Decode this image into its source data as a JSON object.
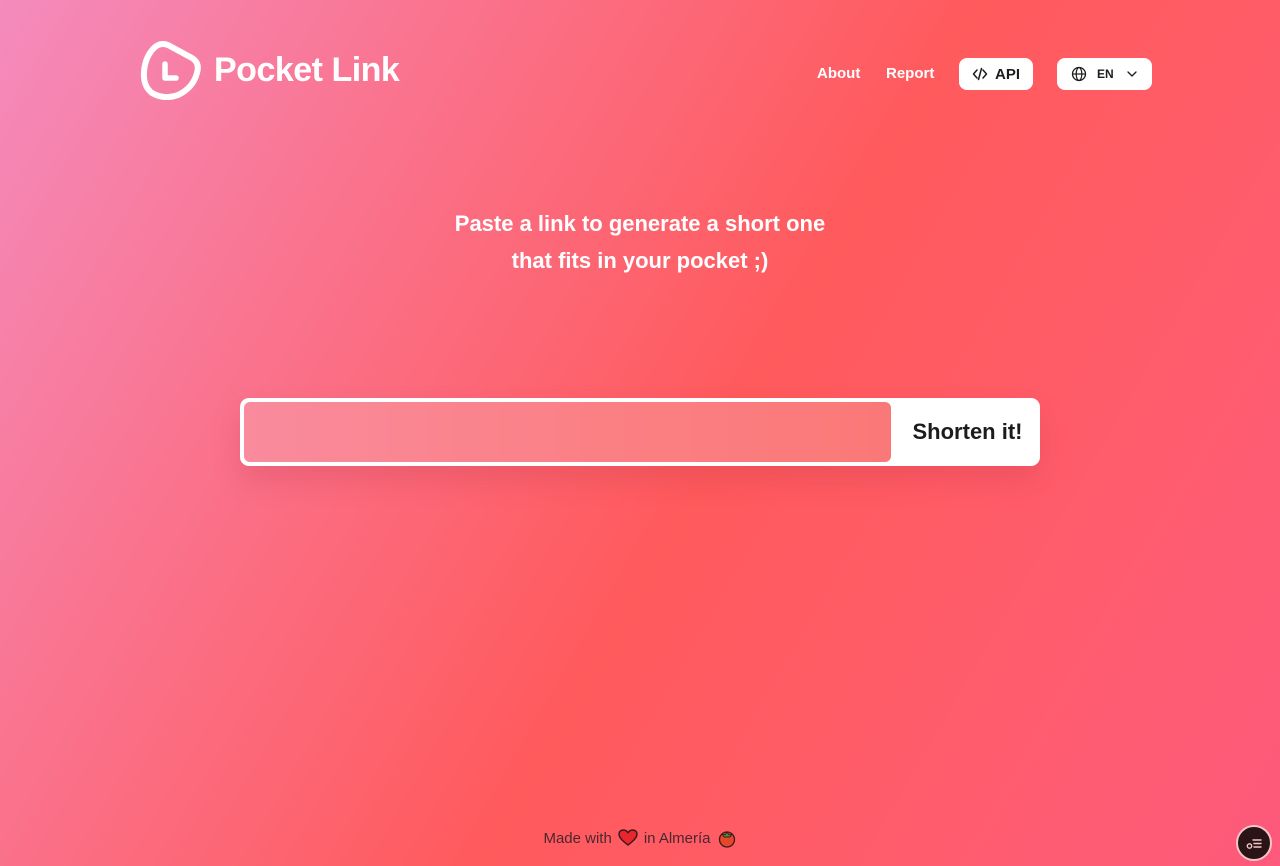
{
  "header": {
    "logo_text": "Pocket Link",
    "nav": {
      "about": "About",
      "report": "Report",
      "api": "API"
    },
    "language": {
      "selected": "EN"
    }
  },
  "hero": {
    "line1": "Paste a link to generate a short one",
    "line2": "that fits in your pocket ;)"
  },
  "form": {
    "input_value": "",
    "input_placeholder": "",
    "submit_label": "Shorten it!"
  },
  "footer": {
    "made_with": "Made with",
    "in_location": "in Almería"
  },
  "colors": {
    "accent_gradient_start": "#f48bbd",
    "accent_gradient_mid": "#ff5a5c",
    "button_bg": "#ffffff",
    "text_dark": "#1c1c1c"
  },
  "icons": {
    "logo": "pocket-link-logo-icon",
    "api": "code-icon",
    "language": "globe-icon",
    "dropdown": "chevron-down-icon",
    "heart": "heart-icon",
    "tomato": "tomato-icon",
    "corner": "settings-toggle-icon"
  }
}
